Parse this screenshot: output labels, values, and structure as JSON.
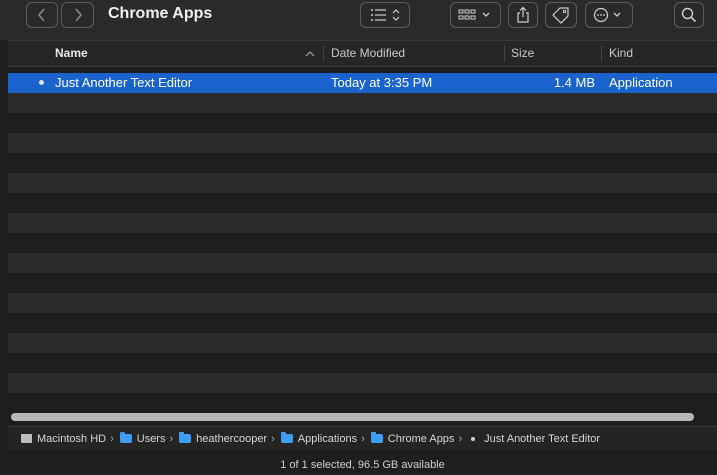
{
  "window": {
    "title": "Chrome Apps"
  },
  "toolbar": {
    "back_icon": "chevron-left-icon",
    "forward_icon": "chevron-right-icon",
    "list_view_icon": "list-view-icon",
    "group_icon": "grid-group-icon",
    "share_icon": "share-icon",
    "tag_icon": "tag-icon",
    "action_icon": "ellipsis-circle-icon",
    "search_icon": "search-icon"
  },
  "columns": {
    "name": "Name",
    "date_modified": "Date Modified",
    "size": "Size",
    "kind": "Kind"
  },
  "files": [
    {
      "name": "Just Another Text Editor",
      "date_modified": "Today at 3:35 PM",
      "size": "1.4 MB",
      "kind": "Application",
      "selected": true
    }
  ],
  "path_bar": [
    {
      "label": "Macintosh HD",
      "icon": "hard-drive-icon"
    },
    {
      "label": "Users",
      "icon": "folder-icon"
    },
    {
      "label": "heathercooper",
      "icon": "folder-icon"
    },
    {
      "label": "Applications",
      "icon": "folder-icon"
    },
    {
      "label": "Chrome Apps",
      "icon": "folder-icon"
    },
    {
      "label": "Just Another Text Editor",
      "icon": "app-icon"
    }
  ],
  "status": {
    "text": "1 of 1 selected, 96.5 GB available"
  },
  "colors": {
    "selection": "#1a63cc",
    "folder": "#3d9df2",
    "background": "#1e1e1e"
  }
}
